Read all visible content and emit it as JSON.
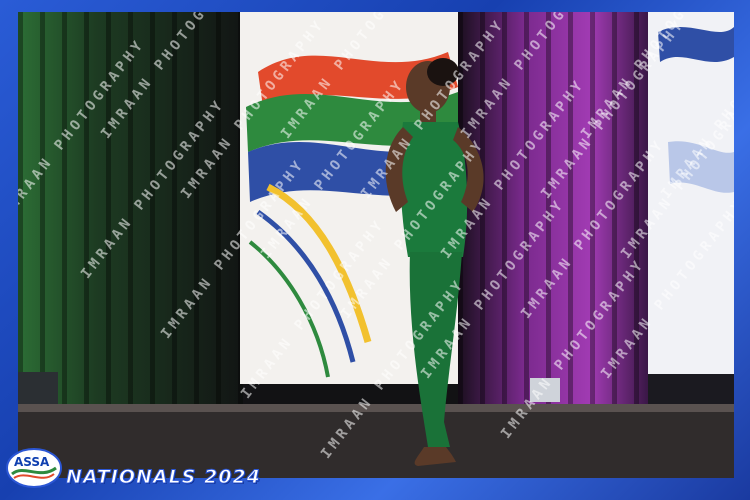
{
  "photo": {
    "watermark_text": "IMRAAN PHOTOGRAPHY",
    "event_title": "NATIONALS 2024",
    "logo_text": "ASSA"
  },
  "colors": {
    "frame": "#1a3fa8",
    "leotard": "#1b7a3c",
    "curtain_green": "#2f7a3a",
    "curtain_purple": "#7a2a8c",
    "flag_red": "#e24a2c",
    "flag_green": "#2e8a3e",
    "flag_blue": "#2f4fa6",
    "flag_yellow": "#f2c12e"
  },
  "icons": [
    "assa-logo"
  ]
}
